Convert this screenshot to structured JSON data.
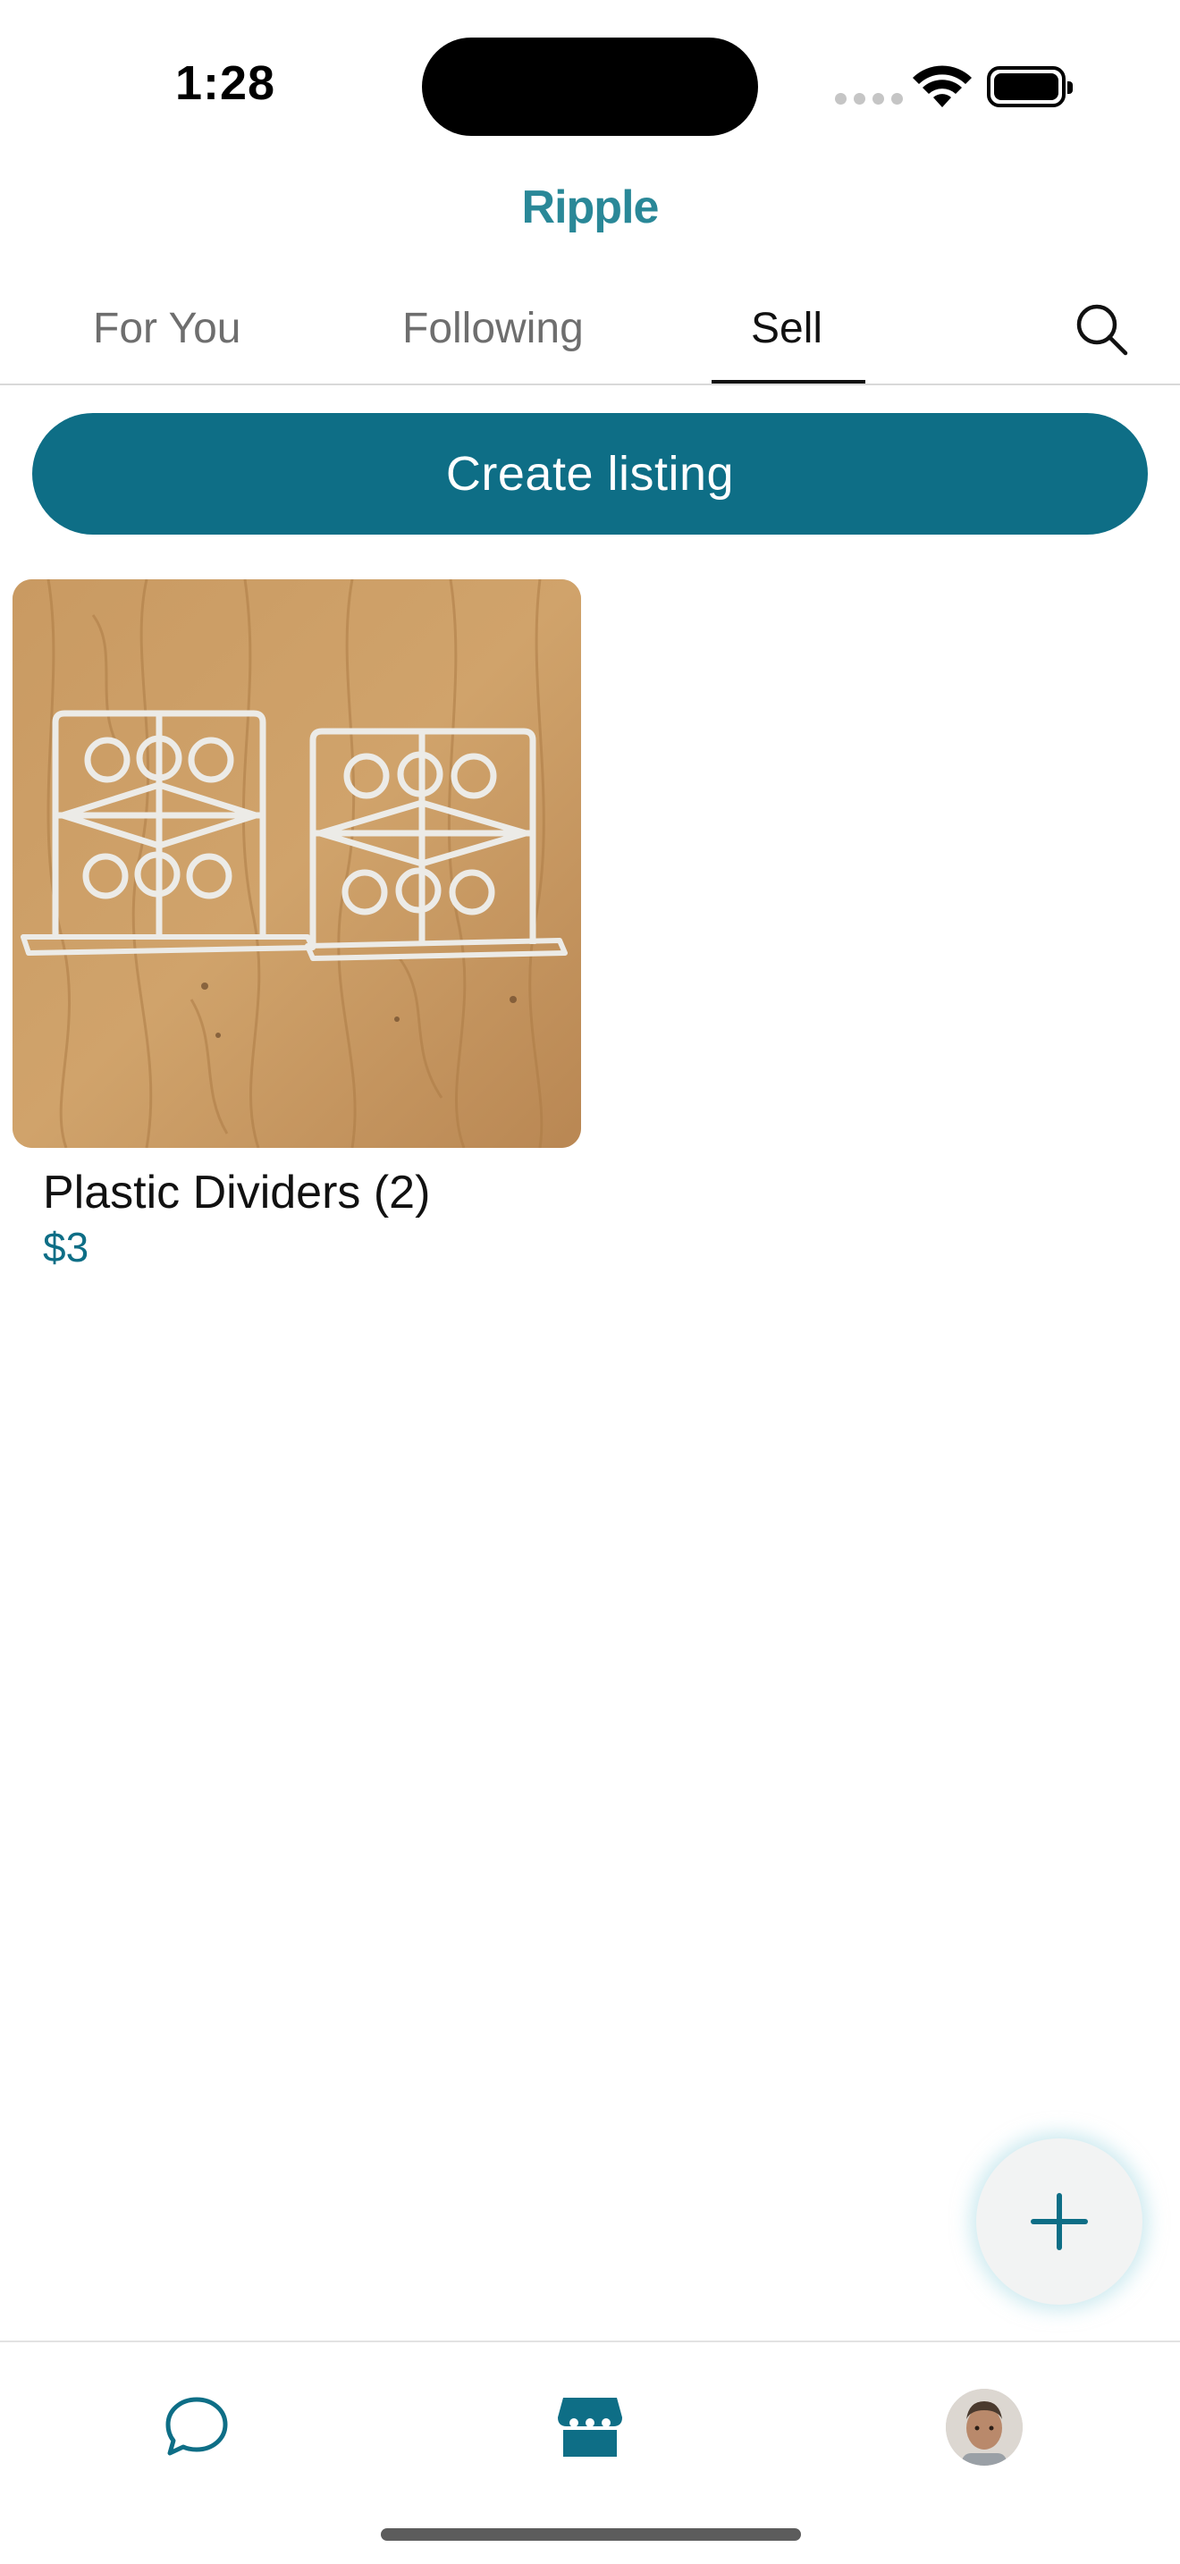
{
  "status_bar": {
    "time": "1:28"
  },
  "header": {
    "app_title": "Ripple"
  },
  "tabs": [
    {
      "label": "For You",
      "active": false
    },
    {
      "label": "Following",
      "active": false
    },
    {
      "label": "Sell",
      "active": true
    }
  ],
  "actions": {
    "create_listing_label": "Create listing"
  },
  "listings": [
    {
      "title": "Plastic Dividers (2)",
      "price": "$3"
    }
  ],
  "colors": {
    "accent": "#0e6e86",
    "title": "#2a8898",
    "inactive_tab": "#6e6e6e"
  },
  "icons": {
    "search": "search-icon",
    "fab": "plus-icon",
    "nav_chat": "chat-bubble-icon",
    "nav_store": "storefront-icon",
    "nav_profile": "avatar"
  },
  "bottom_nav": {
    "active": "store"
  }
}
